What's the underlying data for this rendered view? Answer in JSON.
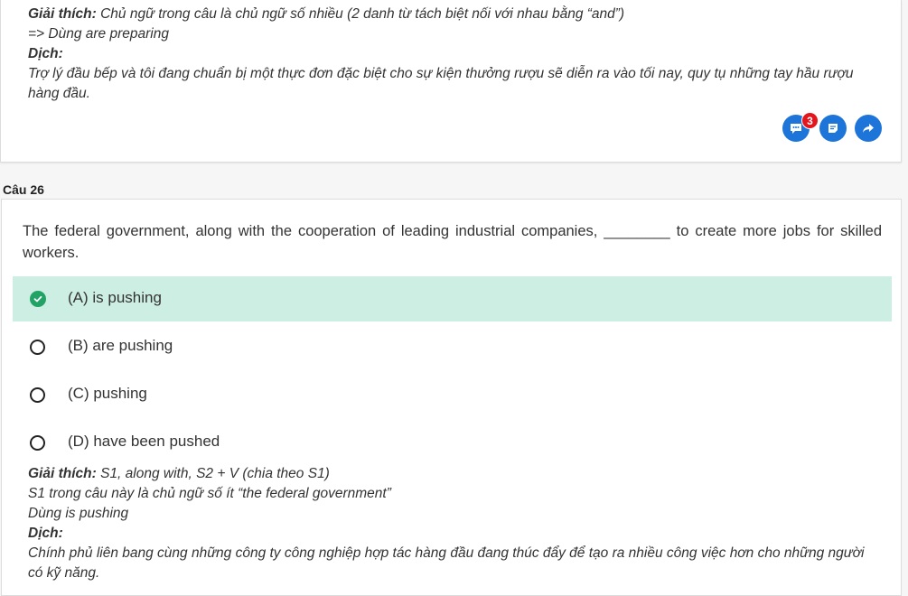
{
  "prev": {
    "line1_label": "Giải thích:",
    "line1_text": " Chủ ngữ trong câu là chủ ngữ số nhiều (2 danh từ tách biệt nối với nhau bằng “and”)",
    "line2": "=> Dùng are preparing",
    "dich_label": "Dịch:",
    "translation": "Trợ lý đầu bếp và tôi đang chuẩn bị một thực đơn đặc biệt cho sự kiện thưởng rượu sẽ diễn ra vào tối nay, quy tụ những tay hầu rượu hàng đầu."
  },
  "actions": {
    "comment_count": "3",
    "colors": {
      "button": "#1d74d9",
      "badge": "#e3161d"
    }
  },
  "question": {
    "label": "Câu 26",
    "text": "The federal government, along with the cooperation of leading industrial companies, ________ to create more jobs for skilled workers.",
    "options": [
      {
        "label": "(A) is pushing",
        "correct": true
      },
      {
        "label": "(B) are pushing",
        "correct": false
      },
      {
        "label": "(C) pushing",
        "correct": false
      },
      {
        "label": "(D) have been pushed",
        "correct": false
      }
    ],
    "explanation": {
      "label": "Giải thích:",
      "line1": " S1, along with, S2 + V (chia theo S1)",
      "line2": "S1 trong câu này là chủ ngữ số ít “the federal government”",
      "line3": "Dùng is pushing",
      "dich_label": "Dịch:",
      "translation": "Chính phủ liên bang cùng những công ty công nghiệp hợp tác hàng đầu đang thúc đẩy để tạo ra nhiều công việc hơn cho những người có kỹ năng."
    },
    "colors": {
      "correct_bg": "#cdeee3",
      "check": "#21a366"
    }
  }
}
